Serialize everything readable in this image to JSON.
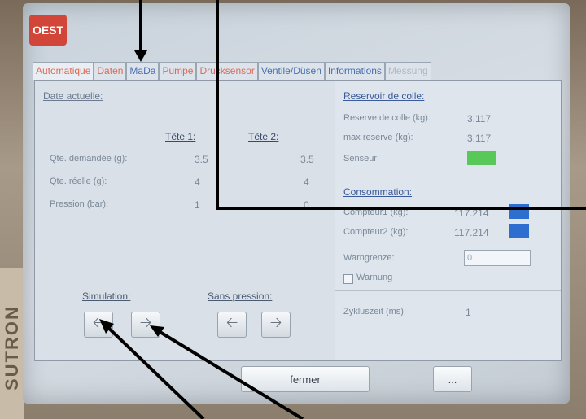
{
  "device": {
    "brand": "SUTRON",
    "logo_text": "OEST"
  },
  "tabs": [
    {
      "label": "Automatique"
    },
    {
      "label": "Daten"
    },
    {
      "label": "MaDa"
    },
    {
      "label": "Pumpe"
    },
    {
      "label": "Drucksensor"
    },
    {
      "label": "Ventile/Düsen"
    },
    {
      "label": "Informations"
    },
    {
      "label": "Messung"
    }
  ],
  "left": {
    "date_label": "Date actuelle:",
    "head1": "Tête 1:",
    "head2": "Tête 2:",
    "rows": [
      {
        "label": "Qte. demandée (g):",
        "v1": "3.5",
        "v2": "3.5"
      },
      {
        "label": "Qte. réelle (g):",
        "v1": "4",
        "v2": "4"
      },
      {
        "label": "Pression (bar):",
        "v1": "1",
        "v2": "0"
      }
    ],
    "simulation_label": "Simulation:",
    "sans_pression_label": "Sans pression:"
  },
  "right": {
    "reservoir_header": "Reservoir de colle:",
    "reserve_label": "Reserve de colle (kg):",
    "reserve_value": "3.117",
    "max_reserve_label": "max reserve (kg):",
    "max_reserve_value": "3.117",
    "sensor_label": "Senseur:",
    "consommation_header": "Consommation:",
    "counter1_label": "Compteur1 (kg):",
    "counter1_value": "117.214",
    "counter2_label": "Compteur2 (kg):",
    "counter2_value": "117.214",
    "warngrenze_label": "Warngrenze:",
    "warngrenze_value": "0",
    "warnung_label": "Warnung",
    "zykluszeit_label": "Zykluszeit (ms):",
    "zykluszeit_value": "1"
  },
  "buttons": {
    "close": "fermer",
    "more": "..."
  },
  "colors": {
    "sensor": "#58c858",
    "counter": "#2d6ecf",
    "active_tab": "#e06a50"
  }
}
